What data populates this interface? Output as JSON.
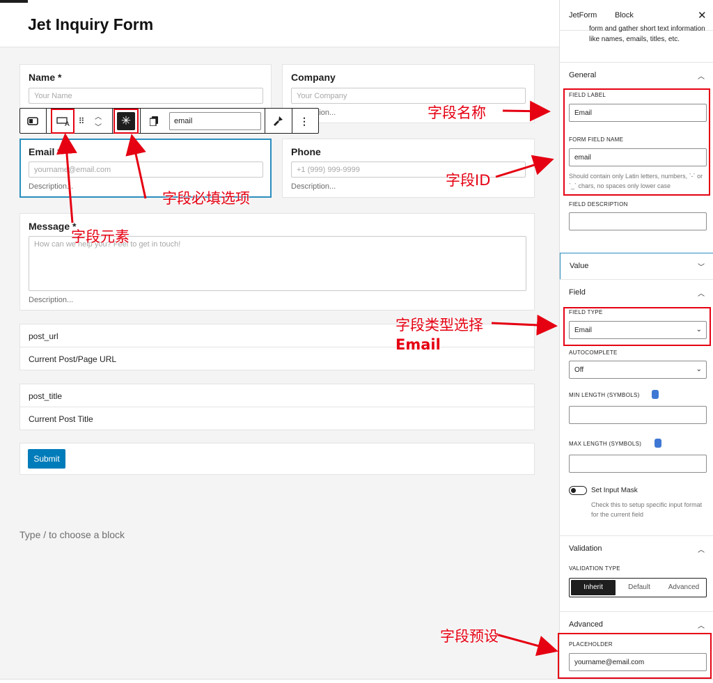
{
  "page": {
    "title": "Jet Inquiry Form"
  },
  "fields": {
    "name": {
      "label": "Name *",
      "placeholder": "Your Name"
    },
    "company": {
      "label": "Company",
      "placeholder": "Your Company",
      "description": "Description..."
    },
    "email": {
      "label": "Email *",
      "placeholder": "yourname@email.com",
      "description": "Description..."
    },
    "phone": {
      "label": "Phone",
      "placeholder": "+1 (999) 999-9999",
      "description": "Description..."
    },
    "message": {
      "label": "Message *",
      "placeholder": "How can we help you? Feel to get in touch!",
      "description": "Description..."
    }
  },
  "hidden_fields": [
    {
      "name": "post_url",
      "value": "Current Post/Page URL"
    },
    {
      "name": "post_title",
      "value": "Current Post Title"
    }
  ],
  "submit_label": "Submit",
  "appender_text": "Type / to choose a block",
  "toolbar": {
    "field_name_value": "email"
  },
  "sidebar": {
    "tabs": [
      "JetForm",
      "Block"
    ],
    "intro": "form and gather short text information like names, emails, titles, etc.",
    "general": {
      "title": "General",
      "field_label_caption": "FIELD LABEL",
      "field_label_value": "Email",
      "form_field_name_caption": "FORM FIELD NAME",
      "form_field_name_value": "email",
      "form_field_name_help": "Should contain only Latin letters, numbers, `-` or `_` chars, no spaces only lower case",
      "field_description_caption": "FIELD DESCRIPTION"
    },
    "value_panel": {
      "title": "Value"
    },
    "field": {
      "title": "Field",
      "field_type_caption": "FIELD TYPE",
      "field_type_value": "Email",
      "autocomplete_caption": "AUTOCOMPLETE",
      "autocomplete_value": "Off",
      "min_length_caption": "MIN LENGTH (SYMBOLS)",
      "max_length_caption": "MAX LENGTH (SYMBOLS)",
      "input_mask_label": "Set Input Mask",
      "input_mask_help": "Check this to setup specific input format for the current field"
    },
    "validation": {
      "title": "Validation",
      "type_caption": "VALIDATION TYPE",
      "options": [
        "Inherit",
        "Default",
        "Advanced"
      ],
      "selected": "Inherit"
    },
    "advanced": {
      "title": "Advanced",
      "placeholder_caption": "PLACEHOLDER",
      "placeholder_value": "yourname@email.com"
    }
  },
  "annotations": {
    "field_name": "字段名称",
    "field_id": "字段ID",
    "required": "字段必填选项",
    "element": "字段元素",
    "type_select": "字段类型选择",
    "type_email": "Email",
    "preset": "字段预设"
  },
  "colors": {
    "accent": "#007cba",
    "annotation": "#e50012",
    "selection": "#2a8dbd"
  },
  "icons": [
    "block-type-icon",
    "field-element-icon",
    "drag-handle-icon",
    "move-up-icon",
    "move-down-icon",
    "required-asterisk-icon",
    "copy-icon",
    "brush-icon",
    "more-options-icon",
    "close-icon",
    "chevron-up-icon",
    "chevron-down-icon",
    "database-icon"
  ]
}
